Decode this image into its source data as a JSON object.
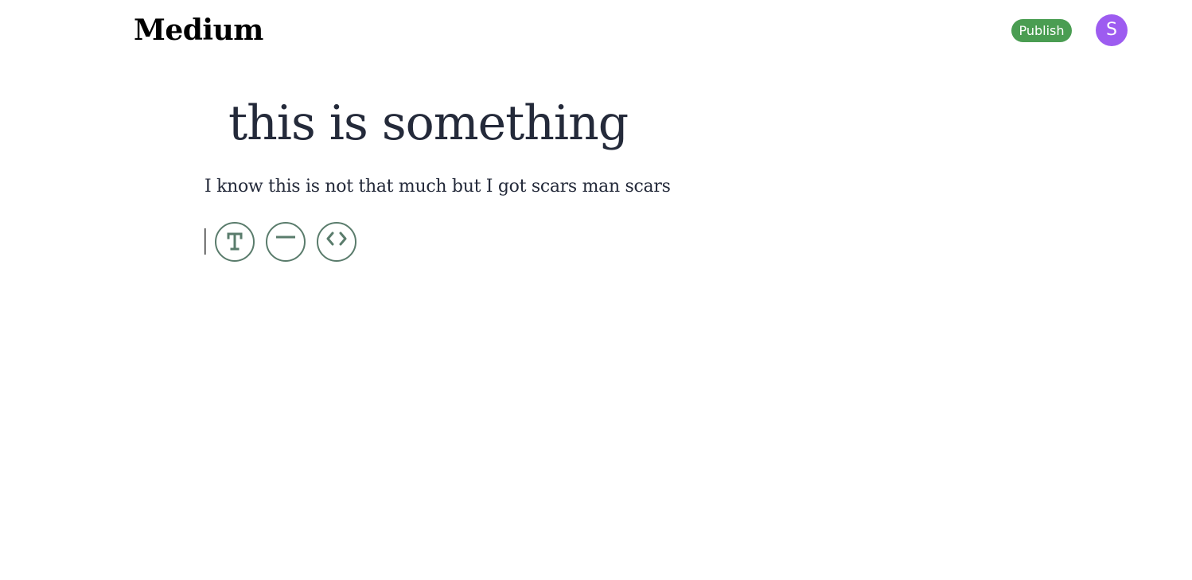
{
  "header": {
    "logo": "Medium",
    "publish_label": "Publish",
    "avatar_initial": "S"
  },
  "editor": {
    "title": "this is something",
    "paragraph": "I know this is not that much but I got scars man scars",
    "toolbar": [
      {
        "icon": "text-icon"
      },
      {
        "icon": "divider-icon"
      },
      {
        "icon": "code-icon"
      }
    ]
  },
  "colors": {
    "publish_green": "#4a9d52",
    "avatar_purple": "#9d5cf0",
    "tool_accent": "#5a7c6c",
    "text_dark": "#242a3a"
  }
}
